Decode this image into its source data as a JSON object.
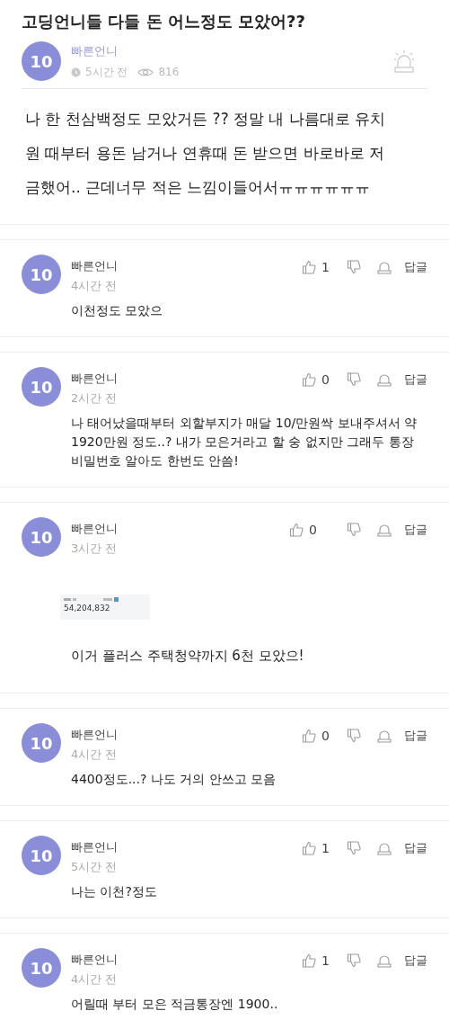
{
  "post": {
    "title": "고딩언니들 다들 돈 어느정도 모았어??",
    "badge": "10",
    "name": "빠른언니",
    "time": "5시간 전",
    "views": "816",
    "body": "나 한 천삼백정도 모았거든 ?? 정말 내 나름대로 유치원 때부터 용돈 남거나 연휴때 돈 받으면 바로바로 저금했어.. 근데너무 적은 느낌이들어서ㅠㅠㅠㅠㅠㅠ"
  },
  "comments": [
    {
      "badge": "10",
      "name": "빠른언니",
      "time": "4시간 전",
      "likes": "1",
      "reply": "답글",
      "body": "이천정도 모았으"
    },
    {
      "badge": "10",
      "name": "빠른언니",
      "time": "2시간 전",
      "likes": "0",
      "reply": "답글",
      "body": "나 태어났을때부터 외할부지가 매달 10/만원싹 보내주셔서 약 1920만원 정도..? 내가 모은거라고 할 숭 없지만 그래두 통장 비밀번호 알아도 한번도 안씀!"
    },
    {
      "badge": "10",
      "name": "빠른언니",
      "time": "3시간 전",
      "likes": "0",
      "reply": "답글",
      "attachment": {
        "amount": "54,204,832"
      },
      "body": "이거 플러스 주택청약까지 6천 모았으!"
    },
    {
      "badge": "10",
      "name": "빠른언니",
      "time": "4시간 전",
      "likes": "0",
      "reply": "답글",
      "body": "4400정도...? 나도 거의 안쓰고 모음"
    },
    {
      "badge": "10",
      "name": "빠른언니",
      "time": "5시간 전",
      "likes": "1",
      "reply": "답글",
      "body": "나는 이천?정도"
    },
    {
      "badge": "10",
      "name": "빠른언니",
      "time": "4시간 전",
      "likes": "1",
      "reply": "답글",
      "body": "어릴때 부터 모은 적금통장엔 1900.."
    }
  ]
}
